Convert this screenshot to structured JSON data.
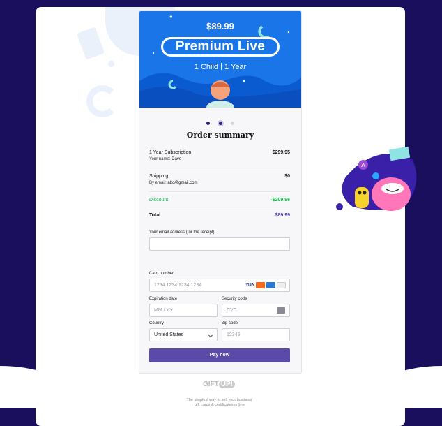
{
  "hero": {
    "price": "$89.99",
    "plan": "Premium Live",
    "child": "1 Child",
    "duration": "1 Year"
  },
  "carousel": {
    "active_index": 1,
    "count": 3
  },
  "summary": {
    "title": "Order summary",
    "subscription_label": "1 Year Subscription",
    "subscription_price": "$299.95",
    "name_label": "Your name:",
    "name_value": "Dave",
    "shipping_label": "Shipping",
    "shipping_price": "$0",
    "email_label": "By email:",
    "email_value": "abc@gmail.com",
    "discount_label": "Discount",
    "discount_value": "-$209.96",
    "total_label": "Total:",
    "total_value": "$89.99"
  },
  "form": {
    "email_label": "Your email address (for the receipt)",
    "email_value": "",
    "card_label": "Card number",
    "card_placeholder": "1234 1234 1234 1234",
    "card_brands": [
      "visa",
      "mastercard",
      "amex",
      "discover"
    ],
    "visa_text": "VISA",
    "expiry_label": "Expiration date",
    "expiry_placeholder": "MM / YY",
    "cvc_label": "Security code",
    "cvc_placeholder": "CVC",
    "country_label": "Country",
    "country_value": "United States",
    "zip_label": "Zip code",
    "zip_placeholder": "12345",
    "pay_label": "Pay now"
  },
  "footer": {
    "logo_left": "GIFT",
    "logo_right": "UP!",
    "tagline_1": "The simplest way to sell your business'",
    "tagline_2": "gift cards & certificates online"
  },
  "colors": {
    "background": "#1a0f5c",
    "hero_blue": "#1a76e8",
    "pay_button": "#5c4aa8",
    "discount_green": "#12b84a",
    "total_purple": "#4a3aa0"
  }
}
